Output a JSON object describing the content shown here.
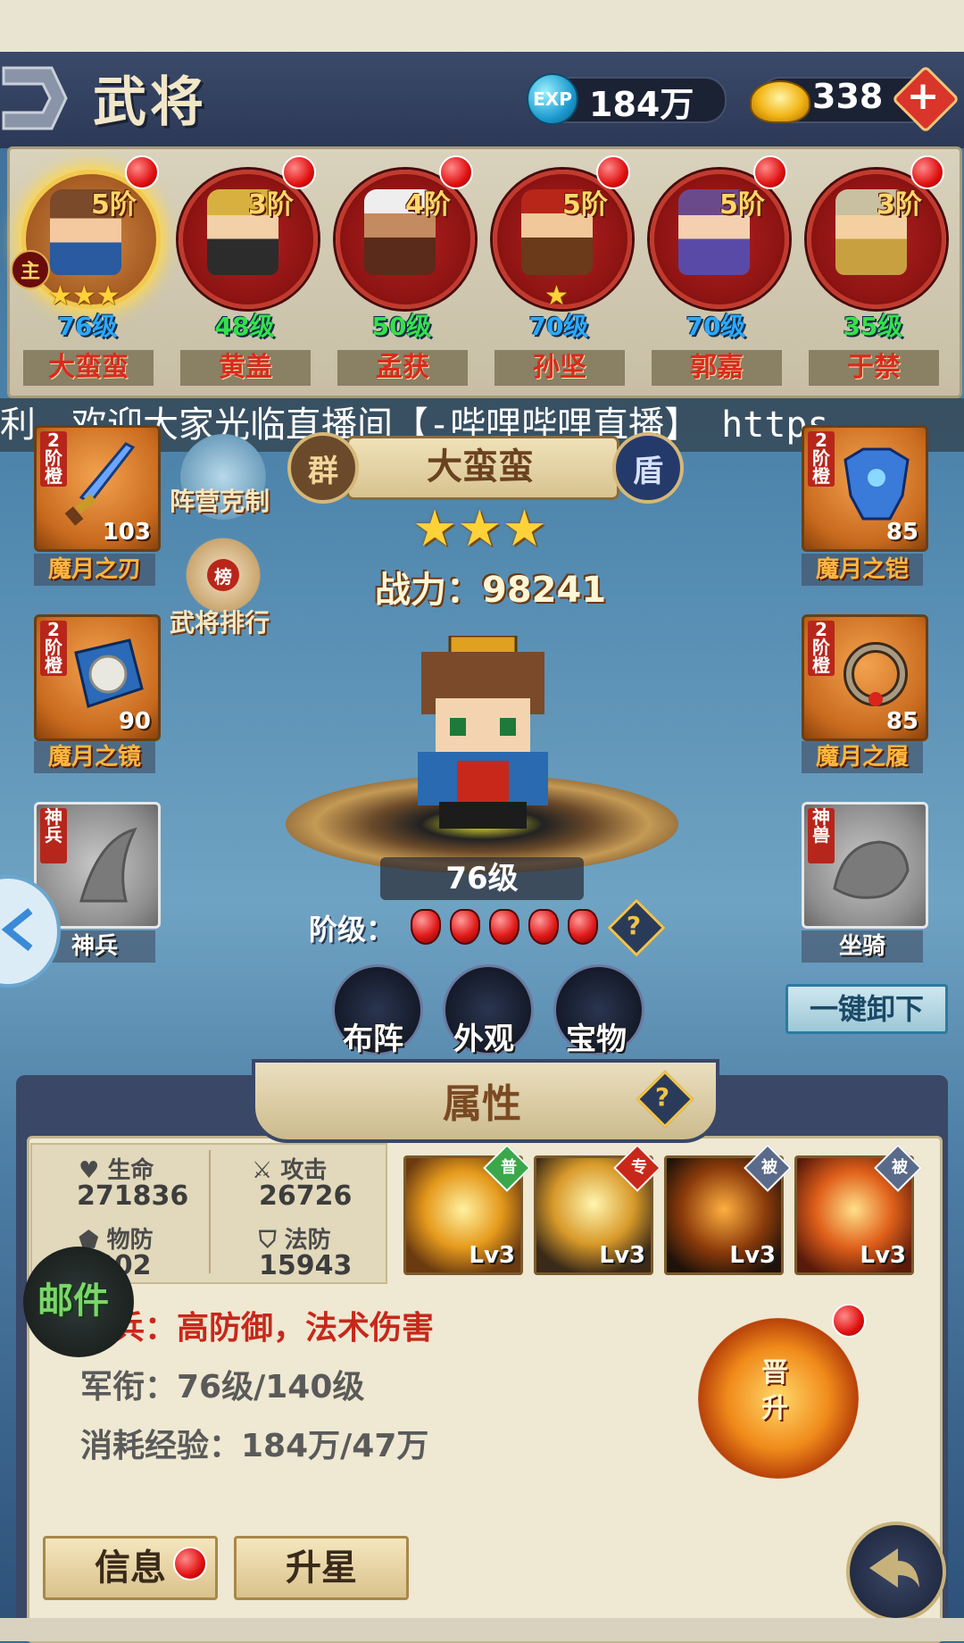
{
  "header": {
    "title": "武将",
    "exp_icon_label": "EXP",
    "exp_value": "184万",
    "gold_value": "338",
    "plus_label": "+"
  },
  "heroes": [
    {
      "tier": "5阶",
      "level": "76级",
      "name": "大蛮蛮",
      "stars": "★★★",
      "selected": true,
      "level_color": "#2aa9ff",
      "lord": "主"
    },
    {
      "tier": "3阶",
      "level": "48级",
      "name": "黄盖",
      "stars": "",
      "level_color": "#34e04a"
    },
    {
      "tier": "4阶",
      "level": "50级",
      "name": "孟获",
      "stars": "",
      "level_color": "#34e04a"
    },
    {
      "tier": "5阶",
      "level": "70级",
      "name": "孙坚",
      "stars": "★",
      "level_color": "#2aa9ff"
    },
    {
      "tier": "5阶",
      "level": "70级",
      "name": "郭嘉",
      "stars": "",
      "level_color": "#2aa9ff"
    },
    {
      "tier": "3阶",
      "level": "35级",
      "name": "于禁",
      "stars": "",
      "level_color": "#34e04a"
    }
  ],
  "marquee": "利，欢迎大家光临直播间【-哔哩哔哩直播】 https",
  "selected_hero": {
    "faction": "群",
    "role": "盾",
    "name": "大蛮蛮",
    "stars": "★★★",
    "power": "战力：98241",
    "level": "76级",
    "rank_label": "阶级："
  },
  "side_buttons": {
    "camp": "阵营克制",
    "ranking": "武将排行",
    "ranking_icon": "榜"
  },
  "equipment_left": [
    {
      "tier": "2阶橙",
      "value": "103",
      "label": "魔月之刃"
    },
    {
      "tier": "2阶橙",
      "value": "90",
      "label": "魔月之镜"
    },
    {
      "tier": "神兵",
      "value": "",
      "label": "神兵"
    }
  ],
  "equipment_right": [
    {
      "tier": "2阶橙",
      "value": "85",
      "label": "魔月之铠"
    },
    {
      "tier": "2阶橙",
      "value": "85",
      "label": "魔月之履"
    },
    {
      "tier": "神兽",
      "value": "",
      "label": "坐骑"
    }
  ],
  "actions": {
    "formation": "布阵",
    "appearance": "外观",
    "treasure": "宝物",
    "unequip_all": "一键卸下",
    "help": "?"
  },
  "attributes": {
    "title": "属性",
    "hp_label": "生命",
    "hp_value": "271836",
    "atk_label": "攻击",
    "atk_value": "26726",
    "pdef_label": "物防",
    "pdef_value": "9002",
    "mdef_label": "法防",
    "mdef_value": "15943"
  },
  "skills": [
    {
      "tag": "普",
      "level": "Lv3",
      "tag_color": "#3aa84a"
    },
    {
      "tag": "专",
      "level": "Lv3",
      "tag_color": "#c8281a"
    },
    {
      "tag": "被",
      "level": "Lv3",
      "tag_color": "#5a6a8a"
    },
    {
      "tag": "被",
      "level": "Lv3",
      "tag_color": "#5a6a8a"
    }
  ],
  "info": {
    "type_prefix": "盾兵：",
    "type_value": "高防御，法术伤害",
    "rank": "军衔：76级/140级",
    "cost": "消耗经验：184万/47万"
  },
  "promote": {
    "label": "晋升"
  },
  "mail": {
    "label": "邮件"
  },
  "tabs": {
    "info": "信息",
    "star_up": "升星"
  },
  "colors": {
    "header_bg": "#2c3856",
    "accent_red": "#e01010",
    "gold": "#ffd23a"
  }
}
